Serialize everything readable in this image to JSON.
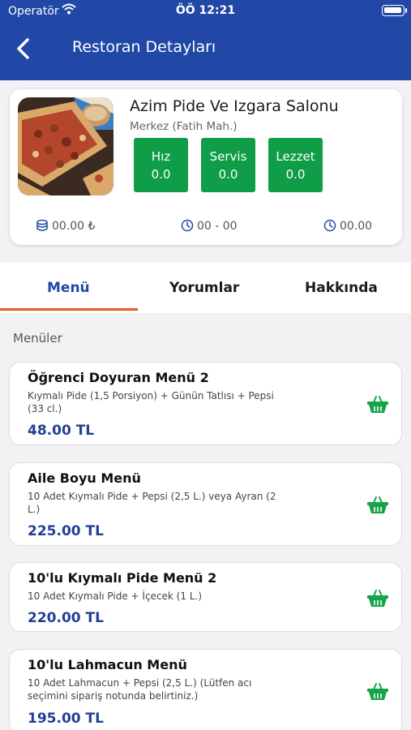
{
  "status_bar": {
    "carrier": "Operatör",
    "time": "ÖÖ 12:21"
  },
  "header": {
    "title": "Restoran Detayları"
  },
  "restaurant": {
    "name": "Azim Pide Ve Izgara Salonu",
    "address": "Merkez (Fatih Mah.)",
    "scores": [
      {
        "label": "Hız",
        "value": "0.0"
      },
      {
        "label": "Servis",
        "value": "0.0"
      },
      {
        "label": "Lezzet",
        "value": "0.0"
      }
    ],
    "min_order": "00.00 ₺",
    "hours": "00 - 00",
    "delivery_time": "00.00"
  },
  "tabs": [
    {
      "label": "Menü",
      "active": true
    },
    {
      "label": "Yorumlar",
      "active": false
    },
    {
      "label": "Hakkında",
      "active": false
    }
  ],
  "section_title": "Menüler",
  "menus": [
    {
      "title": "Öğrenci Doyuran Menü 2",
      "desc": "Kıymalı Pide (1,5 Porsiyon) + Günün Tatlısı + Pepsi (33 cl.)",
      "price": "48.00 TL"
    },
    {
      "title": "Aile Boyu Menü",
      "desc": "10 Adet Kıymalı Pide + Pepsi (2,5 L.) veya Ayran (2 L.)",
      "price": "225.00 TL"
    },
    {
      "title": "10'lu Kıymalı Pide Menü 2",
      "desc": "10 Adet Kıymalı Pide + İçecek (1 L.)",
      "price": "220.00 TL"
    },
    {
      "title": "10'lu Lahmacun Menü",
      "desc": "10 Adet Lahmacun + Pepsi (2,5 L.) (Lütfen acı seçimini sipariş notunda belirtiniz.)",
      "price": "195.00 TL"
    }
  ],
  "colors": {
    "primary": "#2148a7",
    "score_green": "#109d48",
    "cart_green": "#16a34a",
    "tab_indicator": "#e65a2a",
    "price": "#233f95"
  },
  "icons": {
    "back": "chevron-left-icon",
    "cart": "basket-icon",
    "min_order": "coins-icon",
    "hours": "clock-icon",
    "delivery": "clock-icon"
  }
}
